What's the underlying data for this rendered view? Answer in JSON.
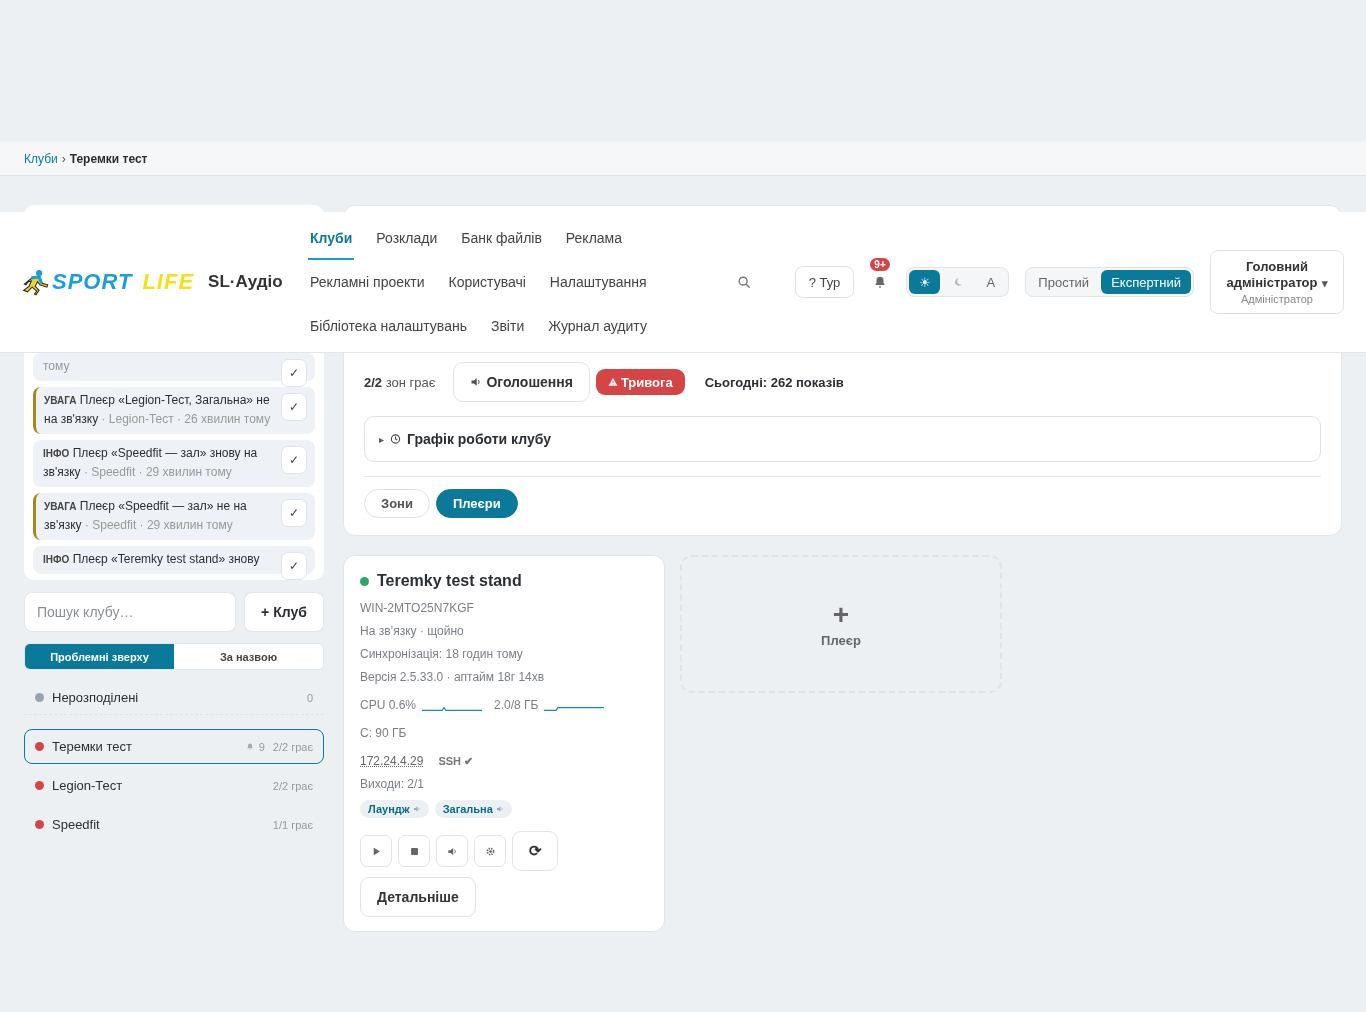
{
  "breadcrumb": {
    "separator": "›",
    "items": [
      {
        "label": "Клуби",
        "link": true
      },
      {
        "label": "Теремки тест",
        "link": false
      }
    ]
  },
  "header": {
    "logo": {
      "word1": "SPORT",
      "word2": "LIFE"
    },
    "app_name": "SL·Аудіо",
    "nav": [
      {
        "label": "Клуби",
        "selected": true
      },
      {
        "label": "Розклади",
        "selected": false
      },
      {
        "label": "Банк файлів",
        "selected": false
      },
      {
        "label": "Реклама",
        "selected": false
      },
      {
        "label": "Рекламні проекти",
        "selected": false
      },
      {
        "label": "Користувачі",
        "selected": false
      },
      {
        "label": "Налаштування",
        "selected": false
      },
      {
        "label": "Бібліотека налаштувань",
        "selected": false
      },
      {
        "label": "Звіти",
        "selected": false
      },
      {
        "label": "Журнал аудиту",
        "selected": false
      }
    ],
    "tour_button": "? Тур",
    "notifications_badge": "9+",
    "theme_options": [
      {
        "kind": "light",
        "label": "☀",
        "selected": true
      },
      {
        "kind": "dark",
        "selected": false
      },
      {
        "kind": "auto",
        "label": "A",
        "selected": false
      }
    ],
    "modes": [
      {
        "label": "Простий",
        "selected": false
      },
      {
        "label": "Експертний",
        "selected": true
      }
    ],
    "user": {
      "name": "Головний адміністратор",
      "caret": "▾",
      "role": "Адміністратор"
    }
  },
  "notifications": [
    {
      "kind": "info",
      "meta": "тому"
    },
    {
      "kind": "warning",
      "tag": "УВАГА",
      "text": "Плеєр «Legion-Тест, Загальна» не на зв'язку",
      "meta": " · Legion-Тест · 26 хвилин тому"
    },
    {
      "kind": "info",
      "tag": "ІНФО",
      "text": "Плеєр «Speedfit — зал» знову на зв'язку",
      "meta": " · Speedfit · 29 хвилин тому"
    },
    {
      "kind": "warning",
      "tag": "УВАГА",
      "text": "Плеєр «Speedfit — зал» не на зв'язку",
      "meta": " · Speedfit · 29 хвилин тому"
    },
    {
      "kind": "info",
      "tag": "ІНФО",
      "text": "Плеєр «Teremky test stand» знову"
    }
  ],
  "ack_mark": "✓",
  "club_search": {
    "placeholder": "Пошук клубу…"
  },
  "add_club_button": "+ Клуб",
  "sort_options": [
    {
      "label": "Проблемні зверху",
      "selected": true
    },
    {
      "label": "За назвою",
      "selected": false
    }
  ],
  "clubs": [
    {
      "name": "Нерозподілені",
      "color": "#9aa3ad",
      "playing": "0",
      "selected": false,
      "group_end": true
    },
    {
      "name": "Теремки тест",
      "color": "#d64545",
      "alerts": "9",
      "playing": "2/2 грає",
      "selected": true
    },
    {
      "name": "Legion-Тест",
      "color": "#d64545",
      "playing": "2/2 грає",
      "selected": false
    },
    {
      "name": "Speedfit",
      "color": "#d64545",
      "playing": "1/1 грає",
      "selected": false
    }
  ],
  "club": {
    "zones_playing": "**2/2** зон грає",
    "announce_button": "Оголошення",
    "alarm_button": "Тривога",
    "today": "Сьогодні: 262 показів",
    "schedule": {
      "marker": "▸",
      "title": "Графік роботи клубу",
      "expanded": false
    },
    "view_tabs": [
      {
        "label": "Зони",
        "selected": false
      },
      {
        "label": "Плеєри",
        "selected": true
      }
    ]
  },
  "players": [
    {
      "color": "#2fa866",
      "name": "Teremky test stand",
      "hostname": "WIN-2MTO25N7KGF",
      "status": "На зв’язку · щойно",
      "sync": "Синхронізація: 18 годин тому",
      "version": "Версія 2.5.33.0 · аптайм 18г 14хв",
      "cpu": "CPU 0.6%",
      "memory": "2.0/8 ГБ",
      "disk": "C: 90 ГБ",
      "ip": "172.24.4.29",
      "ssh": "SSH ✔",
      "outputs": "Виходи: 2/1",
      "zones": [
        "Лаундж",
        "Загальна"
      ],
      "refresh_button": "⟳",
      "details_button": "Детальніше"
    }
  ],
  "add_player": {
    "plus": "+",
    "label": "Плеєр"
  }
}
